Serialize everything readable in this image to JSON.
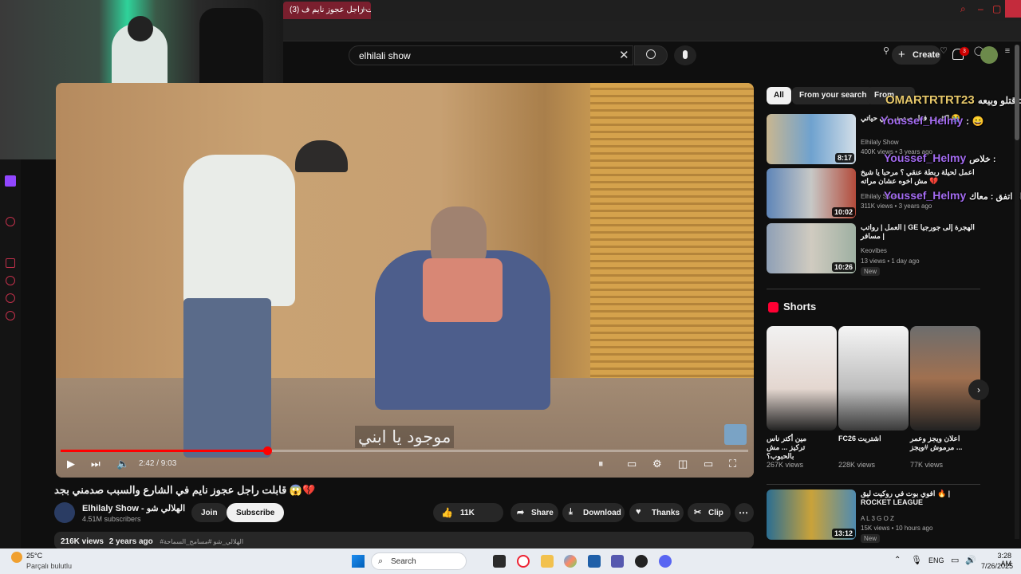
{
  "browser": {
    "active_tab_title": "(3) قابلت راجل عجوز نايم ف",
    "new_tab_glyph": "+"
  },
  "search": {
    "query": "elhilali show"
  },
  "header": {
    "create_label": "Create",
    "notification_count": "3"
  },
  "video": {
    "subtitle": "موجود يا ابني",
    "time": "2:42 / 9:03",
    "progress_fraction": 0.3,
    "title": "قابلت راجل عجوز نايم في الشارع والسبب صدمني بجد 😱💔"
  },
  "channel": {
    "name": "Elhilaly Show - الهلالي شو",
    "subscribers": "4.51M subscribers",
    "join_label": "Join",
    "subscribe_label": "Subscribe"
  },
  "actions": {
    "likes": "11K",
    "share": "Share",
    "download": "Download",
    "thanks": "Thanks",
    "clip": "Clip"
  },
  "description": {
    "views": "216K views",
    "age": "2 years ago",
    "tags": "#الهلالي_شو #مسامح_السماحة"
  },
  "filters": {
    "all": "All",
    "from_search": "From your search",
    "from": "From"
  },
  "recommendations": [
    {
      "title": "اكثر رد فعل صدمني في حياتي 😭",
      "channel": "Elhilaly Show",
      "meta": "400K views • 3 years ago",
      "duration": "8:17",
      "badge": ""
    },
    {
      "title": "اعمل لحيلة ربطة عنقي ؟ مرحبا يا شيخ 💔 مش اخوه عشان مراته",
      "channel": "Elhilaly Show",
      "meta": "311K views • 3 years ago",
      "duration": "10:02",
      "badge": ""
    },
    {
      "title": "العمل | رواتب | GE الهجرة إلى جورجيا | مسافر",
      "channel": "Keovibes",
      "meta": "13 views • 1 day ago",
      "duration": "10:26",
      "badge": "New"
    }
  ],
  "shorts": {
    "heading": "Shorts",
    "items": [
      {
        "title": "مين أكتر ناس تركيز ... مش بالحبوب؟",
        "views": "267K views"
      },
      {
        "title": "FC26 اشتريت",
        "views": "228K views"
      },
      {
        "title": "اعلان ويجز وعمر ... مرموش #ويجز",
        "views": "77K views"
      }
    ]
  },
  "bottom_rec": {
    "title": "افوي بوت في روكيت ليق 🔥 | ROCKET LEAGUE",
    "channel": "A L 3 G O Z",
    "meta": "15K views • 10 hours ago",
    "duration": "13:12",
    "badge": "New"
  },
  "chat": [
    {
      "user": "OMARTRTRT23",
      "message": "قتلو وبيعه :",
      "color": "#e7c86a"
    },
    {
      "user": "Youssef_Helmy",
      "message": ": 😄",
      "color": "#a36bf0"
    },
    {
      "user": "Youssef_Helmy",
      "message": "خلاص :",
      "color": "#a36bf0"
    },
    {
      "user": "Youssef_Helmy",
      "message": "انا اتفق : معاك",
      "color": "#a36bf0"
    }
  ],
  "taskbar": {
    "weather_temp": "25°C",
    "weather_desc": "Parçalı bulutlu",
    "search_label": "Search",
    "language": "ENG",
    "time": "3:28 AM",
    "date": "7/26/2025"
  }
}
